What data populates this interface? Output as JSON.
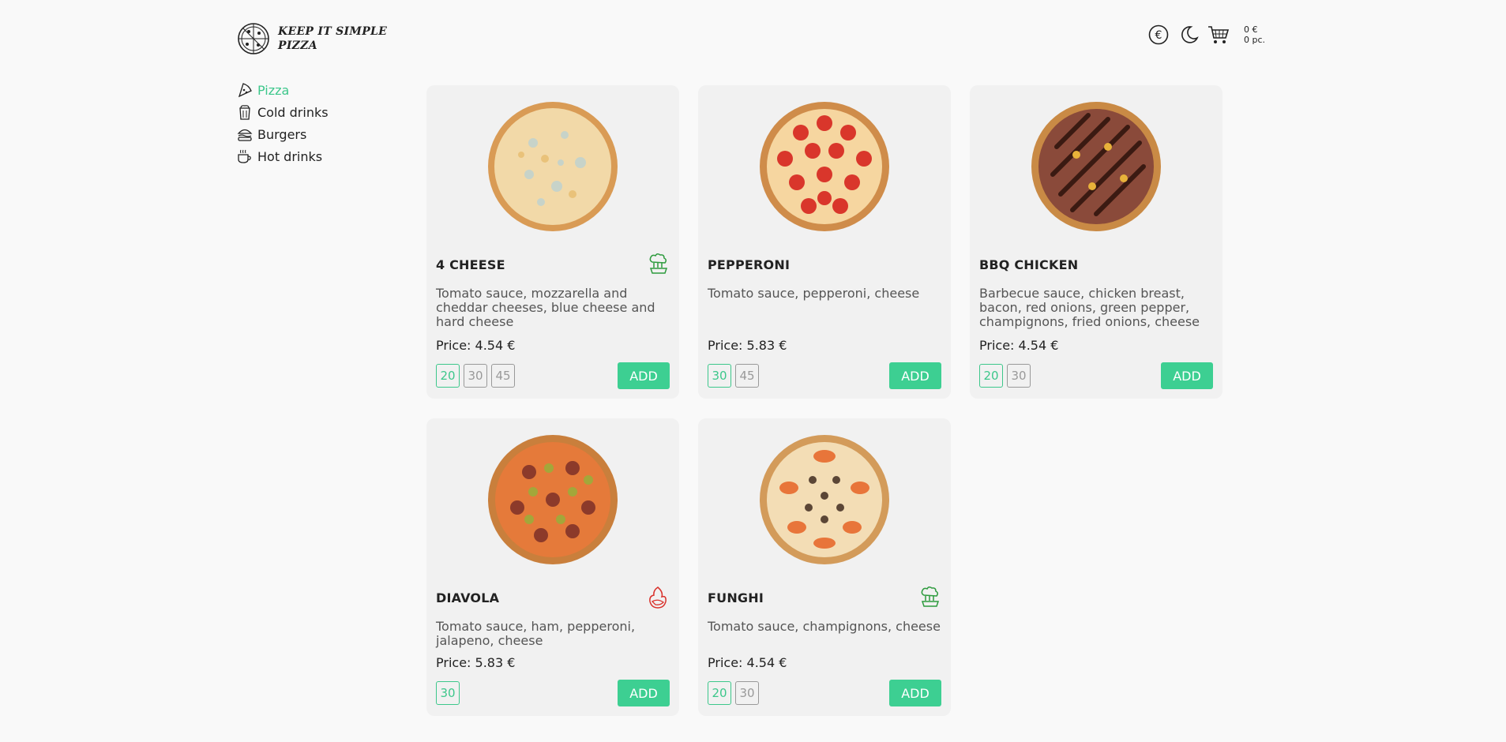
{
  "header": {
    "logo_line1": "KEEP IT SIMPLE",
    "logo_line2": "PIZZA",
    "cart_total": "0 €",
    "cart_count": "0 pc."
  },
  "categories": [
    {
      "label": "Pizza",
      "icon": "pizza-slice-icon",
      "active": true
    },
    {
      "label": "Cold drinks",
      "icon": "cold-drink-icon",
      "active": false
    },
    {
      "label": "Burgers",
      "icon": "burger-icon",
      "active": false
    },
    {
      "label": "Hot drinks",
      "icon": "hot-drink-icon",
      "active": false
    }
  ],
  "products": [
    {
      "title": "4 CHEESE",
      "description": "Tomato sauce, mozzarella and cheddar cheeses, blue cheese and hard cheese",
      "price": "Price: 4.54 €",
      "badge": "vegetarian-icon",
      "sizes": [
        "20",
        "30",
        "45"
      ],
      "selected_size": "20",
      "add_label": "ADD"
    },
    {
      "title": "PEPPERONI",
      "description": "Tomato sauce, pepperoni, cheese",
      "price": "Price: 5.83 €",
      "badge": "",
      "sizes": [
        "30",
        "45"
      ],
      "selected_size": "30",
      "add_label": "ADD"
    },
    {
      "title": "BBQ CHICKEN",
      "description": "Barbecue sauce, chicken breast, bacon, red onions, green pepper, champignons, fried onions, cheese",
      "price": "Price: 4.54 €",
      "badge": "",
      "sizes": [
        "20",
        "30"
      ],
      "selected_size": "20",
      "add_label": "ADD"
    },
    {
      "title": "DIAVOLA",
      "description": "Tomato sauce, ham, pepperoni, jalapeno, cheese",
      "price": "Price: 5.83 €",
      "badge": "spicy-icon",
      "sizes": [
        "30"
      ],
      "selected_size": "30",
      "add_label": "ADD"
    },
    {
      "title": "FUNGHI",
      "description": "Tomato sauce, champignons, cheese",
      "price": "Price: 4.54 €",
      "badge": "vegetarian-icon",
      "sizes": [
        "20",
        "30"
      ],
      "selected_size": "20",
      "add_label": "ADD"
    }
  ],
  "colors": {
    "accent": "#3dc78b",
    "add_button": "#3dcf92",
    "veg_badge": "#2e9b3e",
    "spicy_badge": "#d9312b"
  }
}
